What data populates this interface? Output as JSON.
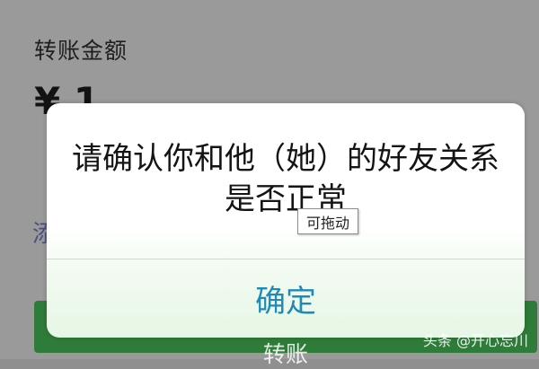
{
  "background": {
    "label": "转账金额",
    "amount": "¥ 1",
    "note": "添",
    "transfer_button_label": "转账"
  },
  "alert": {
    "message": "请确认你和他（她）的好友关系是否正常",
    "confirm_label": "确定"
  },
  "tooltip": {
    "label": "可拖动"
  },
  "watermark": {
    "text": "头条 @开心忘川"
  }
}
